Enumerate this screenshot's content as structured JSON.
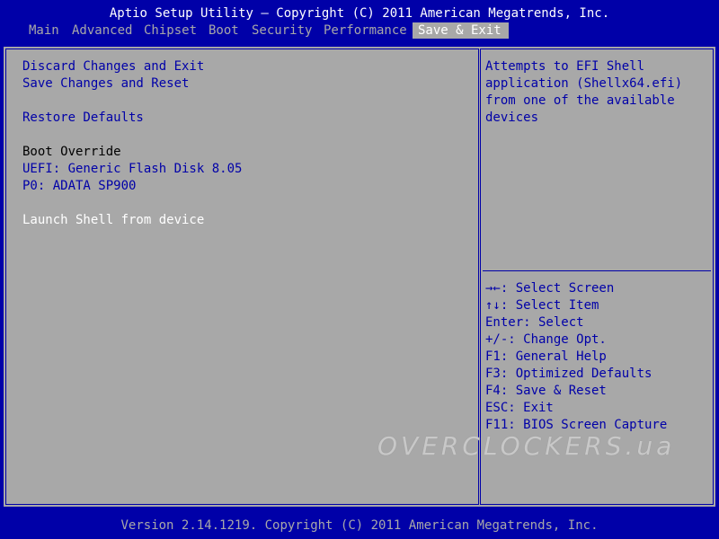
{
  "header": {
    "title": "Aptio Setup Utility – Copyright (C) 2011 American Megatrends, Inc."
  },
  "tabs": [
    {
      "label": "Main"
    },
    {
      "label": "Advanced"
    },
    {
      "label": "Chipset"
    },
    {
      "label": "Boot"
    },
    {
      "label": "Security"
    },
    {
      "label": "Performance"
    },
    {
      "label": "Save & Exit",
      "active": true
    }
  ],
  "menu": {
    "discard_changes_exit": "Discard Changes and Exit",
    "save_changes_reset": "Save Changes and Reset",
    "restore_defaults": "Restore Defaults",
    "boot_override_heading": "Boot Override",
    "boot_uefi_flash": "UEFI: Generic Flash Disk 8.05",
    "boot_p0_adata": "P0: ADATA SP900",
    "launch_shell": "Launch Shell from device"
  },
  "help": {
    "lines": [
      "Attempts to EFI Shell",
      "application (Shellx64.efi)",
      "from one of the available",
      "devices"
    ]
  },
  "keys": [
    "→←: Select Screen",
    "↑↓: Select Item",
    "Enter: Select",
    "+/-: Change Opt.",
    "F1: General Help",
    "F3: Optimized Defaults",
    "F4: Save & Reset",
    "ESC: Exit",
    "F11: BIOS Screen Capture"
  ],
  "watermark": "OVERCLOCKERS.ua",
  "footer": {
    "version": "Version 2.14.1219. Copyright (C) 2011 American Megatrends, Inc."
  },
  "colors": {
    "background": "#0000a8",
    "panel": "#a8a8a8",
    "option_text": "#0000a8",
    "selected_text": "#ffffff",
    "heading_text": "#000000"
  }
}
